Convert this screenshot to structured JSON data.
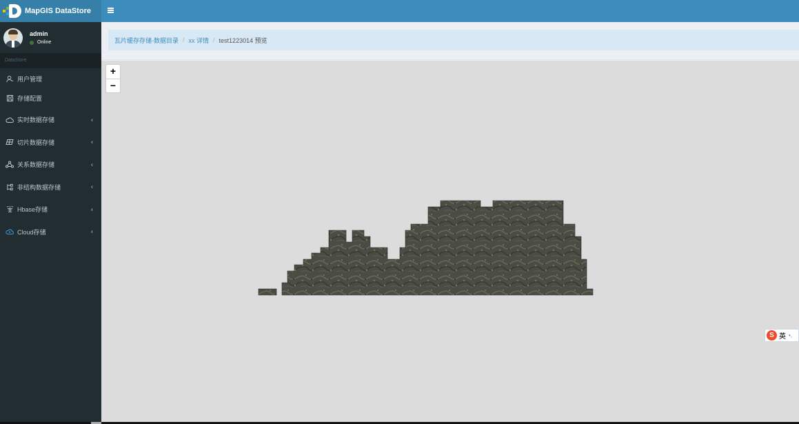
{
  "app": {
    "logo_text": "MapGIS DataStore"
  },
  "user": {
    "name": "admin",
    "status": "Online"
  },
  "sidebar": {
    "header": "DataStore",
    "items": [
      {
        "label": "用户管理",
        "icon": "user-icon",
        "has_submenu": false
      },
      {
        "label": "存储配置",
        "icon": "save-icon",
        "has_submenu": false
      },
      {
        "label": "实时数据存储",
        "icon": "cloud-outline-icon",
        "has_submenu": true
      },
      {
        "label": "切片数据存储",
        "icon": "tiles-icon",
        "has_submenu": true
      },
      {
        "label": "关系数据存储",
        "icon": "network-icon",
        "has_submenu": true
      },
      {
        "label": "非结构数据存储",
        "icon": "file-structure-icon",
        "has_submenu": true
      },
      {
        "label": "Hbase存储",
        "icon": "hbase-icon",
        "has_submenu": true
      },
      {
        "label": "Cloud存储",
        "icon": "cloud-icon",
        "has_submenu": true
      }
    ]
  },
  "breadcrumb": {
    "items": [
      "瓦片缓存存储-数据目录",
      "xx 详情"
    ],
    "current": "test1223014 预览"
  },
  "map": {
    "zoom_in": "+",
    "zoom_out": "−",
    "background": "#dcdcdc"
  },
  "ime": {
    "logo": "S",
    "lang": "英"
  },
  "colors": {
    "navbar": "#3c8dbc",
    "sidebar": "#222d32",
    "breadcrumb_bg": "#d9e8f5",
    "online": "#3c763d"
  }
}
